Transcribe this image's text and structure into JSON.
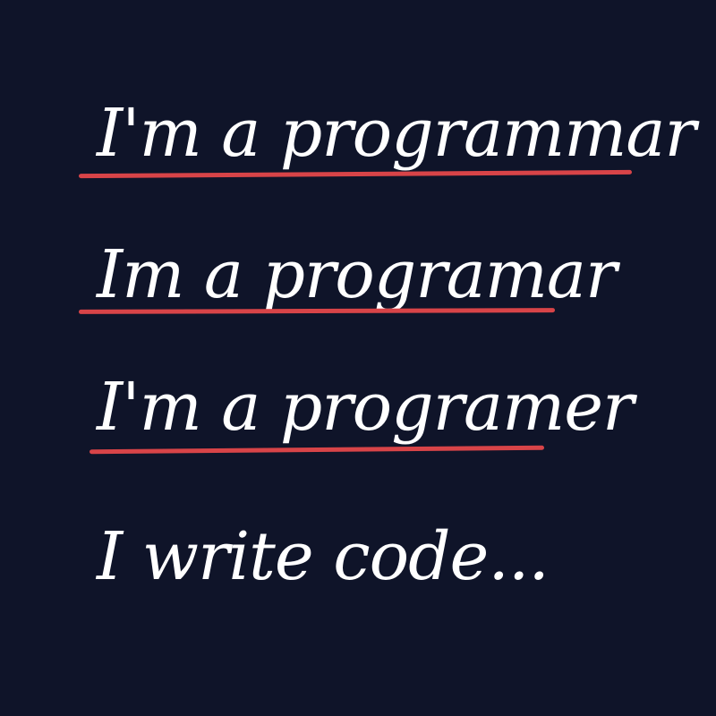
{
  "poster": {
    "lines": [
      {
        "text": "I'm a programmar",
        "struck": true
      },
      {
        "text": "Im a programar",
        "struck": true
      },
      {
        "text": "I'm a programer",
        "struck": true
      },
      {
        "text": "I write code...",
        "struck": false
      }
    ],
    "colors": {
      "background": "#0f1429",
      "text": "#ffffff",
      "strike": "#d84448"
    }
  }
}
